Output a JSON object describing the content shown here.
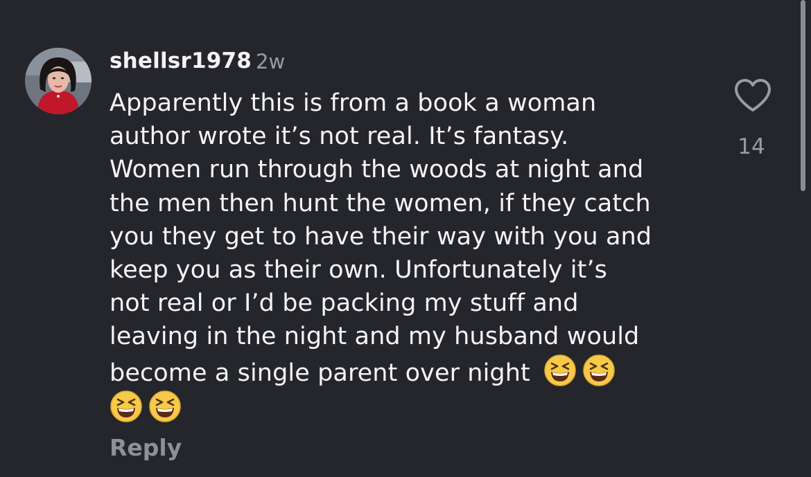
{
  "comment": {
    "username": "shellsr1978",
    "timestamp": "2w",
    "text_lines": [
      "Apparently this is from a book a woman",
      "author wrote it’s not real. It’s fantasy.",
      "Women run through the woods at night and",
      "the men then hunt the women, if they catch",
      "you they get to have their way with you and",
      "keep you as their own. Unfortunately it’s",
      "not real or I’d be packing my stuff and",
      "leaving in the night and my husband would",
      "become a single parent over night"
    ],
    "emoji_icon": "grinning-squinting-face-icon",
    "emoji_count": 4,
    "reply_label": "Reply",
    "like_count": "14"
  },
  "colors": {
    "background": "#25262b",
    "text": "#f5f5f7",
    "muted": "#9a9ca3"
  }
}
